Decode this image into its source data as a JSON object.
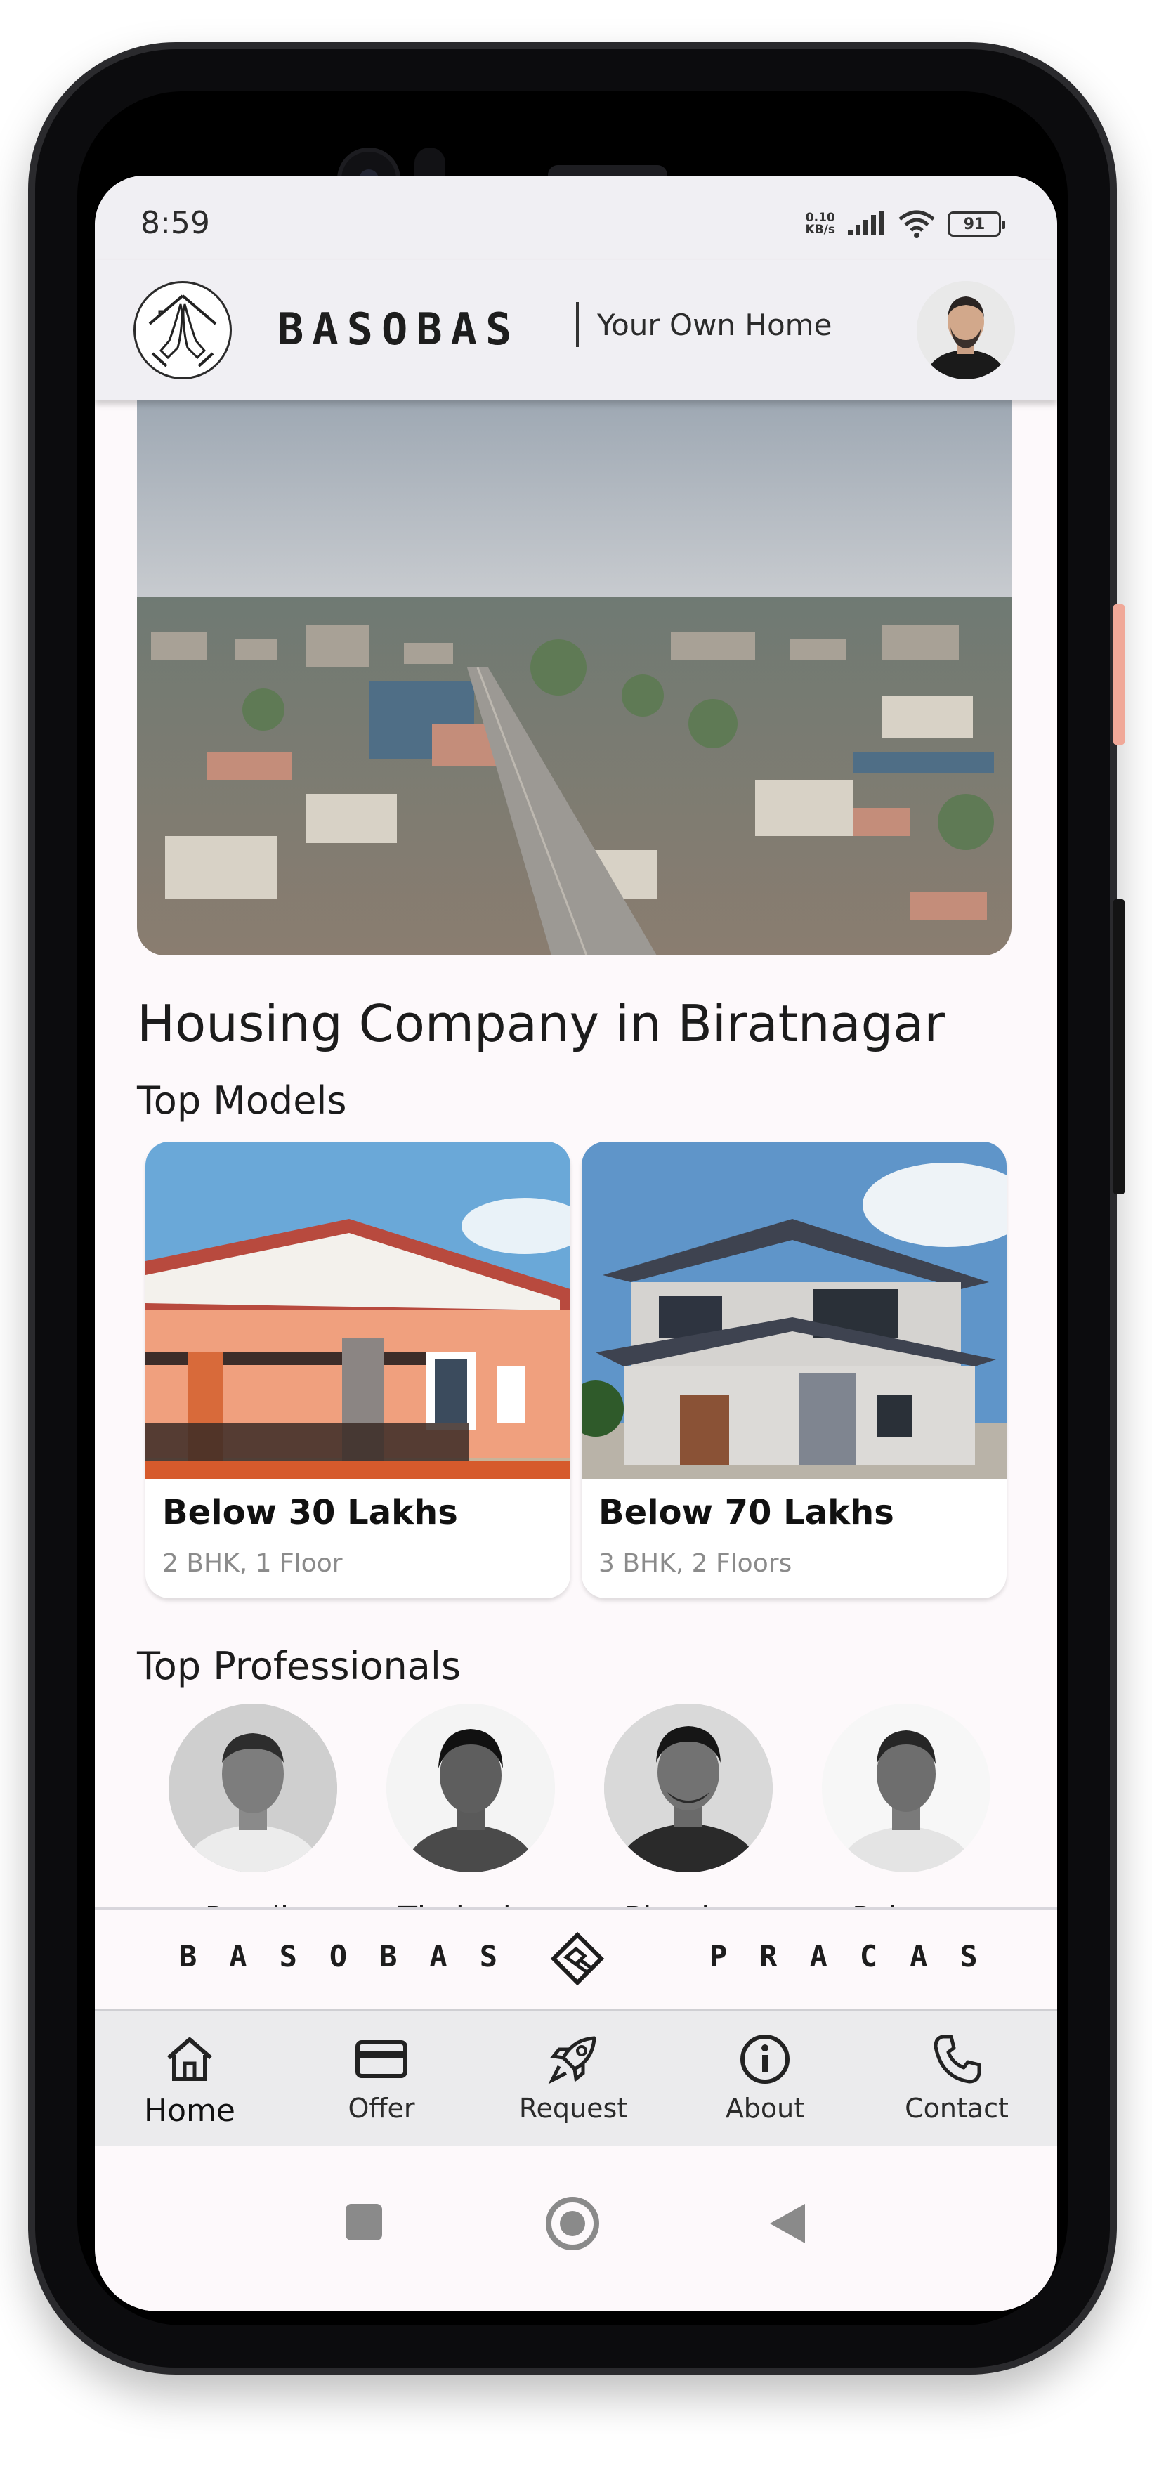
{
  "status_bar": {
    "time": "8:59",
    "net_speed_value": "0.10",
    "net_speed_unit": "KB/s",
    "battery": "91"
  },
  "header": {
    "brand": "BASOBAS",
    "tagline": "Your Own Home"
  },
  "main": {
    "title": "Housing Company in Biratnagar",
    "top_models_title": "Top Models",
    "models": [
      {
        "title": "Below 30 Lakhs",
        "subtitle": "2 BHK, 1 Floor"
      },
      {
        "title": "Below 70 Lakhs",
        "subtitle": "3 BHK, 2 Floors"
      }
    ],
    "top_professionals_title": "Top Professionals",
    "professionals": [
      {
        "label": "Pandit"
      },
      {
        "label": "Thekedar"
      },
      {
        "label": "Plumber"
      },
      {
        "label": "Painter"
      }
    ]
  },
  "partner_bar": {
    "left": "BASOBAS",
    "right": "PRACAS",
    "icon": "handshake-icon"
  },
  "bottom_nav": {
    "items": [
      {
        "label": "Home",
        "icon": "home-icon",
        "active": true
      },
      {
        "label": "Offer",
        "icon": "credit-card-icon",
        "active": false
      },
      {
        "label": "Request",
        "icon": "rocket-icon",
        "active": false
      },
      {
        "label": "About",
        "icon": "info-icon",
        "active": false
      },
      {
        "label": "Contact",
        "icon": "phone-icon",
        "active": false
      }
    ]
  },
  "colors": {
    "screen_bg": "#fdf9fb",
    "header_bg": "#f0eff3",
    "nav_bg": "#ebebed",
    "text": "#1c1c1c",
    "muted": "#8b8b8b"
  }
}
